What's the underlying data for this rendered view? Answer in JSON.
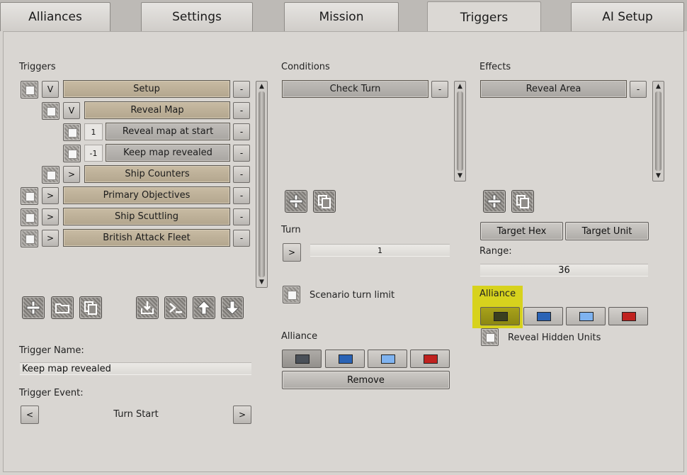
{
  "tabs": [
    {
      "label": "Alliances",
      "active": false
    },
    {
      "label": "Settings",
      "active": false
    },
    {
      "label": "Mission",
      "active": false
    },
    {
      "label": "Triggers",
      "active": true
    },
    {
      "label": "AI Setup",
      "active": false
    }
  ],
  "triggers": {
    "heading": "Triggers",
    "items": [
      {
        "label": "Setup",
        "toggle": "V",
        "style": "tan"
      },
      {
        "label": "Reveal Map",
        "toggle": "V",
        "style": "tan"
      },
      {
        "label": "Reveal map at start",
        "number": "1",
        "style": "grey"
      },
      {
        "label": "Keep map revealed",
        "number": "-1",
        "style": "grey"
      },
      {
        "label": "Ship Counters",
        "toggle": ">",
        "style": "tan"
      },
      {
        "label": "Primary Objectives",
        "toggle": ">",
        "style": "tan"
      },
      {
        "label": "Ship Scuttling",
        "toggle": ">",
        "style": "tan"
      },
      {
        "label": "British Attack Fleet",
        "toggle": ">",
        "style": "tan"
      }
    ],
    "remove_label": "-",
    "name_label": "Trigger Name:",
    "name_value": "Keep map revealed",
    "event_label": "Trigger Event:",
    "event_value": "Turn Start",
    "event_prev": "<",
    "event_next": ">"
  },
  "conditions": {
    "heading": "Conditions",
    "items": [
      {
        "label": "Check Turn"
      }
    ],
    "remove_label": "-",
    "turn_label": "Turn",
    "turn_toggle": ">",
    "turn_value": "1",
    "scenario_turn_limit_label": "Scenario turn limit",
    "alliance_label": "Alliance",
    "remove_button": "Remove"
  },
  "effects": {
    "heading": "Effects",
    "items": [
      {
        "label": "Reveal Area"
      }
    ],
    "remove_label": "-",
    "target_hex": "Target Hex",
    "target_unit": "Target Unit",
    "range_label": "Range:",
    "range_value": "36",
    "alliance_label": "Alliance",
    "reveal_hidden_label": "Reveal Hidden Units"
  },
  "icons": {
    "add": "plus-icon",
    "folder": "folder-icon",
    "copy": "copy-icon",
    "import": "import-icon",
    "console": "console-icon",
    "up": "arrow-up-icon",
    "down": "arrow-down-icon"
  },
  "colors": {
    "alliance_grey": "#4a5058",
    "alliance_blue": "#2a63b5",
    "alliance_lightblue": "#7fb3f0",
    "alliance_red": "#c0221f",
    "alliance_olive": "#3b3f1f",
    "highlight": "#d7d21d",
    "trigger_tan": "#bfb29a"
  }
}
